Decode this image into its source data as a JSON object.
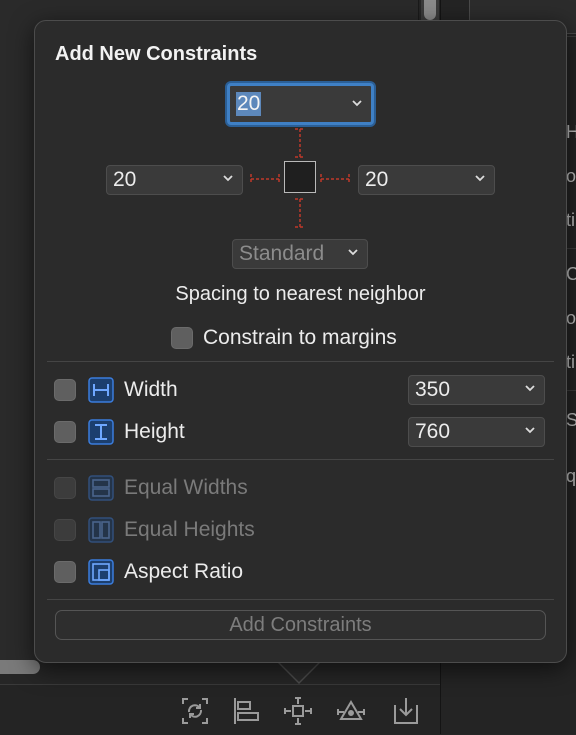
{
  "popover": {
    "title": "Add New Constraints",
    "top_value": "20",
    "left_value": "20",
    "right_value": "20",
    "bottom_value": "Standard",
    "spacing_caption": "Spacing to nearest neighbor",
    "constrain_margins_label": "Constrain to margins",
    "width_label": "Width",
    "width_value": "350",
    "height_label": "Height",
    "height_value": "760",
    "equal_widths_label": "Equal Widths",
    "equal_heights_label": "Equal Heights",
    "aspect_ratio_label": "Aspect Ratio",
    "add_button_label": "Add Constraints"
  },
  "background": {
    "side_fragments": [
      "H",
      "or",
      "ti",
      "Cc",
      "or",
      "ti",
      "S",
      "qu"
    ]
  },
  "colors": {
    "accent": "#3f80c5",
    "constraint_red": "#c0392b",
    "icon_blue": "#3b7ddd"
  },
  "icons": {
    "bottom_bar": [
      "update-frames-icon",
      "align-icon",
      "add-constraints-icon",
      "resolve-issues-icon",
      "embed-in-icon"
    ]
  }
}
